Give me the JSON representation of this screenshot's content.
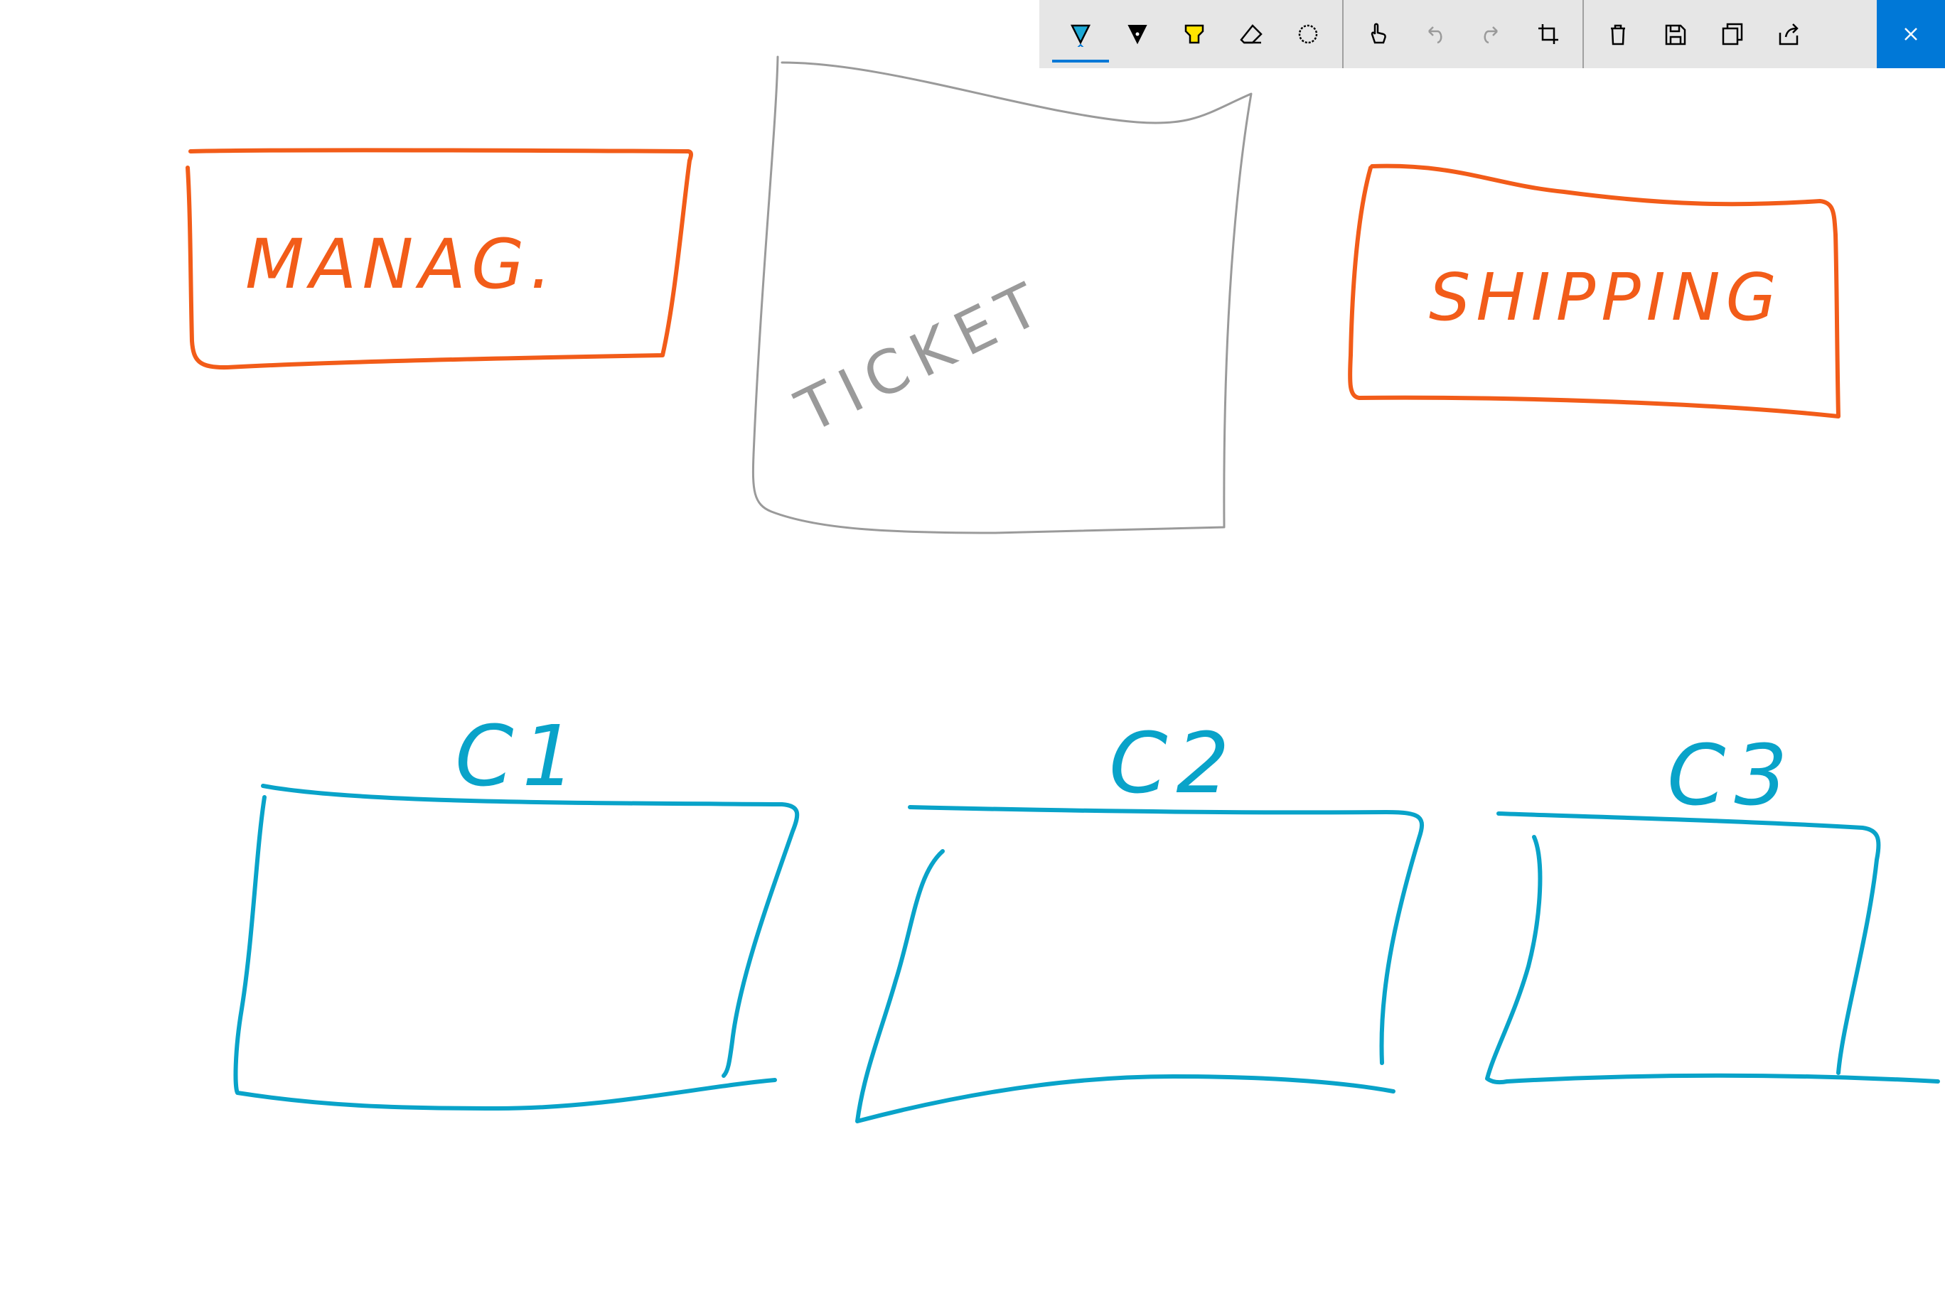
{
  "toolbar": {
    "tools": [
      {
        "name": "ballpoint-pen",
        "icon": "ballpoint-pen-icon",
        "selected": true
      },
      {
        "name": "pencil",
        "icon": "pencil-icon"
      },
      {
        "name": "highlighter",
        "icon": "highlighter-icon"
      },
      {
        "name": "eraser",
        "icon": "eraser-icon"
      },
      {
        "name": "lasso-select",
        "icon": "lasso-icon"
      },
      {
        "name": "touch-writing",
        "icon": "touch-writing-icon"
      },
      {
        "name": "undo",
        "icon": "undo-icon",
        "disabled": true
      },
      {
        "name": "redo",
        "icon": "redo-icon",
        "disabled": true
      },
      {
        "name": "crop",
        "icon": "crop-icon"
      },
      {
        "name": "delete",
        "icon": "trash-icon"
      },
      {
        "name": "save",
        "icon": "save-icon"
      },
      {
        "name": "copy",
        "icon": "copy-icon"
      },
      {
        "name": "share",
        "icon": "share-icon"
      },
      {
        "name": "close",
        "icon": "close-icon"
      }
    ],
    "accent": "#0078d7"
  },
  "sketch": {
    "ink_colors": {
      "orange": "#f25c19",
      "blue": "#09a3c9",
      "gray": "#9a9a9a"
    },
    "labels": {
      "manag": "MANAG.",
      "ticket": "TICKET",
      "shipping": "SHIPPING",
      "c1": "C1",
      "c2": "C2",
      "c3": "C3"
    }
  }
}
